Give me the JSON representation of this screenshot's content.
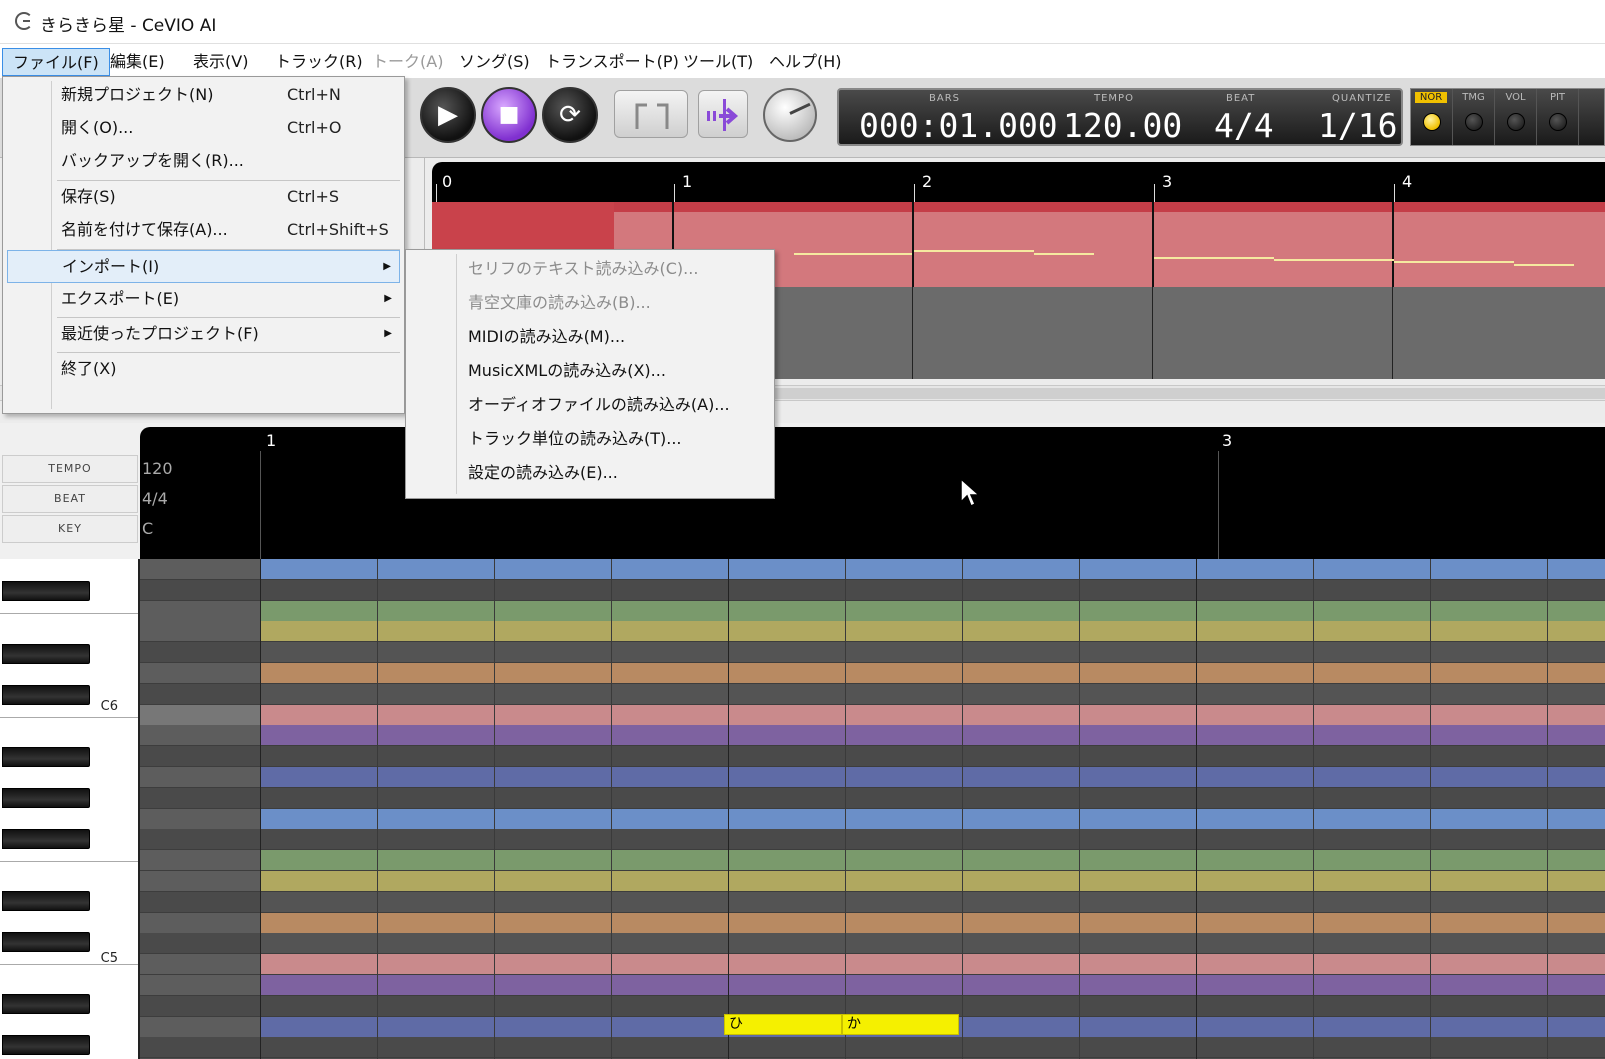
{
  "window": {
    "title": "きらきら星 - CeVIO AI"
  },
  "menubar": [
    {
      "label": "ファイル(F)",
      "active": true,
      "disabled": false
    },
    {
      "label": "編集(E)",
      "active": false,
      "disabled": false
    },
    {
      "label": "表示(V)",
      "active": false,
      "disabled": false
    },
    {
      "label": "トラック(R)",
      "active": false,
      "disabled": false
    },
    {
      "label": "トーク(A)",
      "active": false,
      "disabled": true
    },
    {
      "label": "ソング(S)",
      "active": false,
      "disabled": false
    },
    {
      "label": "トランスポート(P)",
      "active": false,
      "disabled": false
    },
    {
      "label": "ツール(T)",
      "active": false,
      "disabled": false
    },
    {
      "label": "ヘルプ(H)",
      "active": false,
      "disabled": false
    }
  ],
  "file_menu": {
    "items": [
      {
        "label": "新規プロジェクト(N)",
        "shortcut": "Ctrl+N"
      },
      {
        "label": "開く(O)...",
        "shortcut": "Ctrl+O"
      },
      {
        "label": "バックアップを開く(R)...",
        "shortcut": ""
      },
      {
        "label": "保存(S)",
        "shortcut": "Ctrl+S"
      },
      {
        "label": "名前を付けて保存(A)...",
        "shortcut": "Ctrl+Shift+S"
      },
      {
        "label": "インポート(I)",
        "shortcut": "",
        "submenu": true,
        "highlighted": true
      },
      {
        "label": "エクスポート(E)",
        "shortcut": "",
        "submenu": true
      },
      {
        "label": "最近使ったプロジェクト(F)",
        "shortcut": "",
        "submenu": true
      },
      {
        "label": "終了(X)",
        "shortcut": ""
      }
    ]
  },
  "import_submenu": {
    "items": [
      {
        "label": "セリフのテキスト読み込み(C)...",
        "disabled": true
      },
      {
        "label": "青空文庫の読み込み(B)...",
        "disabled": true
      },
      {
        "label": "MIDIの読み込み(M)...",
        "disabled": false
      },
      {
        "label": "MusicXMLの読み込み(X)...",
        "disabled": false
      },
      {
        "label": "オーディオファイルの読み込み(A)...",
        "disabled": false
      },
      {
        "label": "トラック単位の読み込み(T)...",
        "disabled": false
      },
      {
        "label": "設定の読み込み(E)...",
        "disabled": false
      }
    ]
  },
  "transport": {
    "play_icon": "play-icon",
    "stop_icon": "stop-icon",
    "loop_icon": "loop-icon",
    "lcd": {
      "bars_label": "BARS",
      "bars_value": "000:01.000",
      "tempo_label": "TEMPO",
      "tempo_value": "120.00",
      "beat_label": "BEAT",
      "beat_value": "4/4",
      "quantize_label": "QUANTIZE",
      "quantize_value": "1/16"
    },
    "indicators": [
      {
        "label": "NOR",
        "on": true
      },
      {
        "label": "TMG",
        "on": false
      },
      {
        "label": "VOL",
        "on": false
      },
      {
        "label": "PIT",
        "on": false
      }
    ]
  },
  "track_ruler": {
    "marks": [
      "0",
      "1",
      "2",
      "3",
      "4"
    ]
  },
  "piano_roll": {
    "header_labels": {
      "tempo": "TEMPO",
      "beat": "BEAT",
      "key": "KEY"
    },
    "tempo_value": "120",
    "beat_value": "4/4",
    "key_value": "C",
    "ruler_marks": [
      "1",
      "3"
    ],
    "key_labels": [
      "C6",
      "C5"
    ],
    "notes": [
      {
        "lyric": "ひ"
      },
      {
        "lyric": "か"
      }
    ]
  },
  "colors": {
    "row_blue": "#6b8fc8",
    "row_green": "#7a9a6c",
    "row_olive": "#b0a860",
    "row_orange": "#b88a62",
    "row_pink": "#c98a8c",
    "row_purple": "#7e62a0",
    "row_indigo": "#5f6ba6",
    "note_yellow": "#f5f000",
    "track_red": "#c43e48"
  }
}
